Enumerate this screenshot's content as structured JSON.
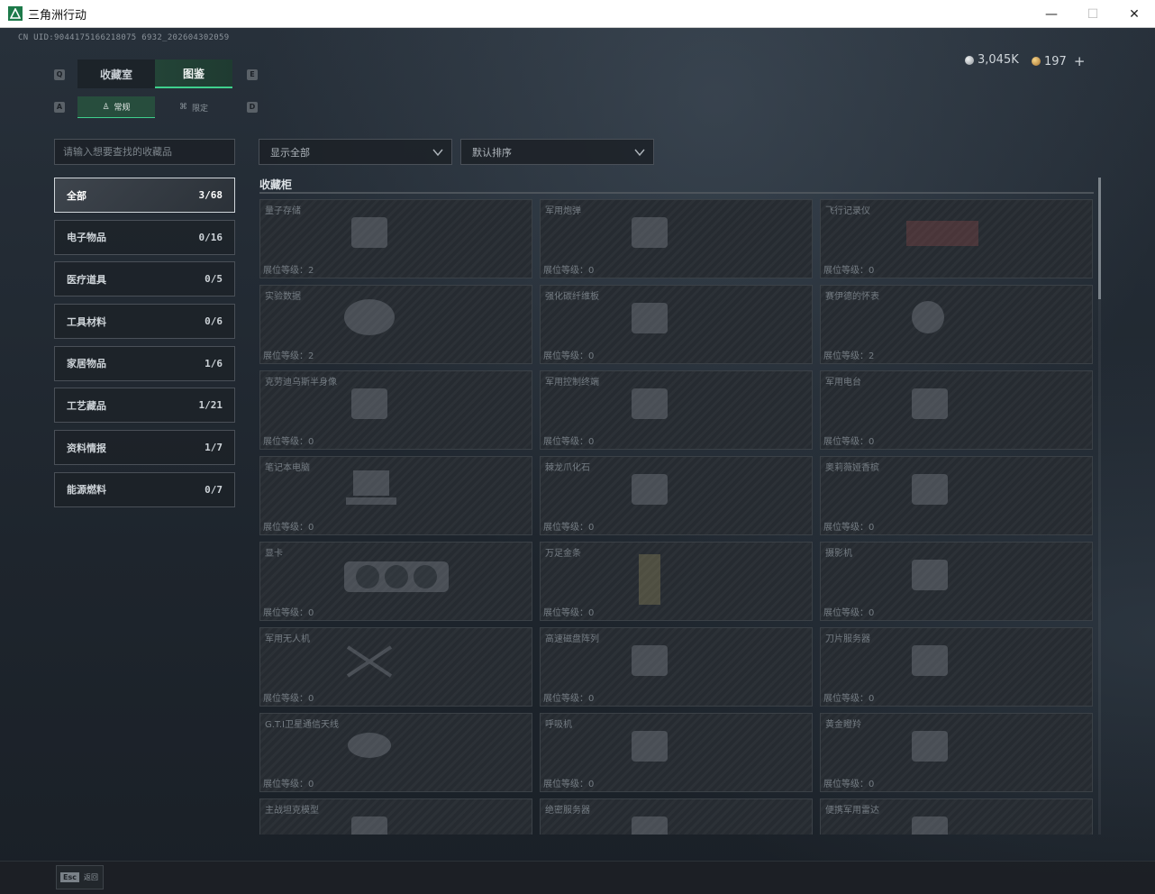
{
  "window": {
    "title": "三角洲行动",
    "minimize": "—",
    "maximize": "☐",
    "close": "✕"
  },
  "header": {
    "uid": "CN UID:9044175166218075 6932_202604302059",
    "currency_silver": "3,045K",
    "currency_gold": "197",
    "add_label": "+"
  },
  "tabs": {
    "main": [
      {
        "label": "收藏室",
        "key": "Q"
      },
      {
        "label": "图鉴",
        "key": "E"
      }
    ],
    "sub": [
      {
        "label": "常规",
        "icon": "♙"
      },
      {
        "label": "限定",
        "icon": "⌘"
      }
    ],
    "key_left": "Q",
    "key_right": "E",
    "subkey_left": "A",
    "subkey_right": "D"
  },
  "search": {
    "placeholder": "请输入想要查找的收藏品"
  },
  "categories": [
    {
      "label": "全部",
      "count": "3/68"
    },
    {
      "label": "电子物品",
      "count": "0/16"
    },
    {
      "label": "医疗道具",
      "count": "0/5"
    },
    {
      "label": "工具材料",
      "count": "0/6"
    },
    {
      "label": "家居物品",
      "count": "1/6"
    },
    {
      "label": "工艺藏品",
      "count": "1/21"
    },
    {
      "label": "资料情报",
      "count": "1/7"
    },
    {
      "label": "能源燃料",
      "count": "0/7"
    }
  ],
  "filters": {
    "show": "显示全部",
    "sort": "默认排序"
  },
  "section_title": "收藏柜",
  "level_prefix": "展位等级：",
  "items": [
    {
      "name": "量子存储",
      "level": "2",
      "icon": "usb-drive-icon"
    },
    {
      "name": "军用炮弹",
      "level": "0",
      "icon": "shell-icon"
    },
    {
      "name": "飞行记录仪",
      "level": "0",
      "icon": "recorder-icon"
    },
    {
      "name": "实验数据",
      "level": "2",
      "icon": "disc-icon"
    },
    {
      "name": "强化碳纤维板",
      "level": "0",
      "icon": "plate-icon"
    },
    {
      "name": "赛伊德的怀表",
      "level": "2",
      "icon": "pocket-watch-icon"
    },
    {
      "name": "克劳迪乌斯半身像",
      "level": "0",
      "icon": "bust-icon"
    },
    {
      "name": "军用控制终端",
      "level": "0",
      "icon": "terminal-icon"
    },
    {
      "name": "军用电台",
      "level": "0",
      "icon": "radio-icon"
    },
    {
      "name": "笔记本电脑",
      "level": "0",
      "icon": "laptop-icon"
    },
    {
      "name": "棘龙爪化石",
      "level": "0",
      "icon": "fossil-icon"
    },
    {
      "name": "奥莉薇娅香槟",
      "level": "0",
      "icon": "bottle-icon"
    },
    {
      "name": "显卡",
      "level": "0",
      "icon": "gpu-icon"
    },
    {
      "name": "万足金条",
      "level": "0",
      "icon": "gold-bar-icon"
    },
    {
      "name": "摄影机",
      "level": "0",
      "icon": "camera-icon"
    },
    {
      "name": "军用无人机",
      "level": "0",
      "icon": "drone-icon"
    },
    {
      "name": "高速磁盘阵列",
      "level": "0",
      "icon": "disk-array-icon"
    },
    {
      "name": "刀片服务器",
      "level": "0",
      "icon": "server-icon"
    },
    {
      "name": "G.T.I卫星通信天线",
      "level": "0",
      "icon": "antenna-icon"
    },
    {
      "name": "呼吸机",
      "level": "0",
      "icon": "ventilator-icon"
    },
    {
      "name": "黄金瞪羚",
      "level": "0",
      "icon": "gazelle-icon"
    },
    {
      "name": "主战坦克模型",
      "level": "",
      "icon": "tank-icon"
    },
    {
      "name": "绝密服务器",
      "level": "",
      "icon": "server-icon"
    },
    {
      "name": "便携军用雷达",
      "level": "",
      "icon": "radar-icon"
    }
  ],
  "footer": {
    "esc_key": "Esc",
    "esc_label": "返回"
  }
}
